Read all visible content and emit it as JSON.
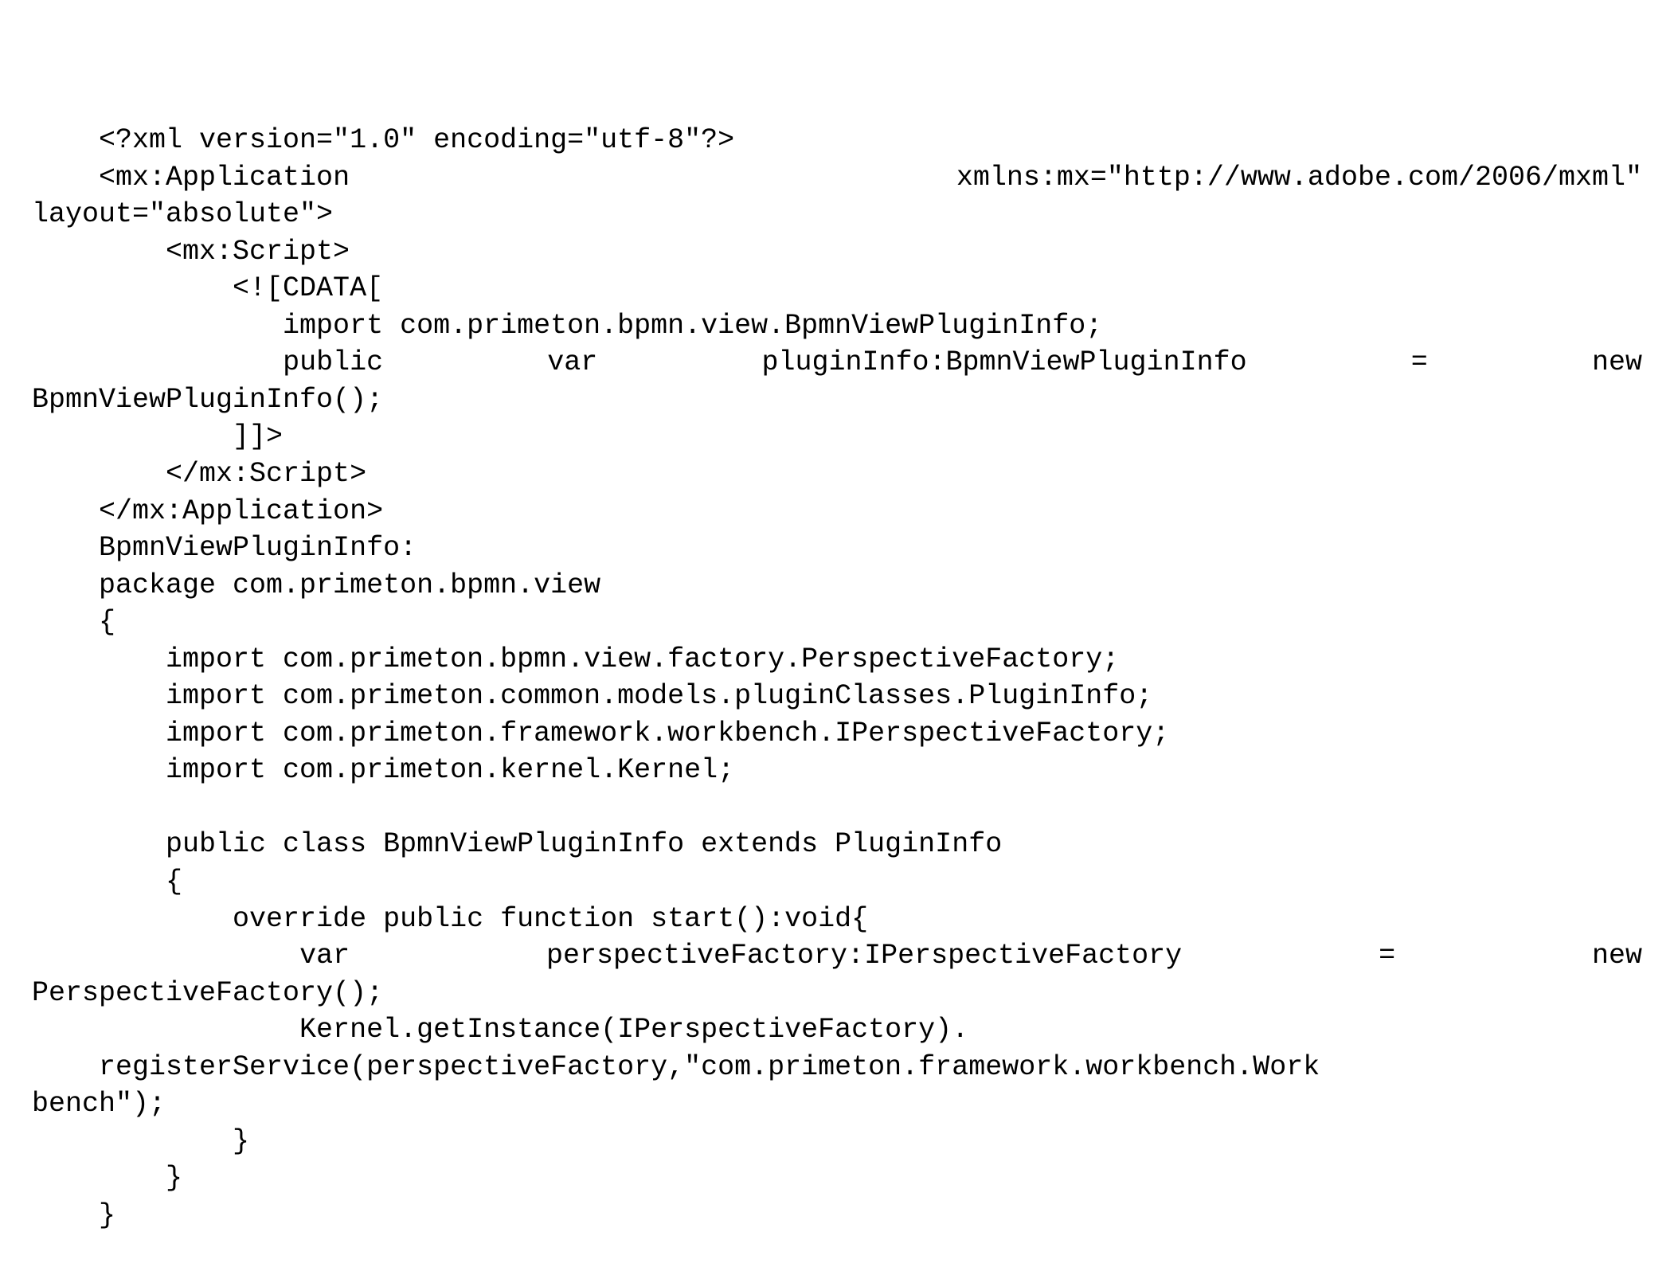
{
  "lines": [
    {
      "indent": "    ",
      "segs": [
        "<?xml version=\"1.0\" encoding=\"utf-8\"?>"
      ]
    },
    {
      "indent": "    ",
      "justify": true,
      "segs": [
        "<mx:Application",
        "xmlns:mx=\"http://www.adobe.com/2006/mxml\""
      ]
    },
    {
      "indent": "",
      "segs": [
        "layout=\"absolute\">"
      ]
    },
    {
      "indent": "        ",
      "segs": [
        "<mx:Script>"
      ]
    },
    {
      "indent": "            ",
      "segs": [
        "<![CDATA["
      ]
    },
    {
      "indent": "               ",
      "segs": [
        "import com.primeton.bpmn.view.BpmnViewPluginInfo;"
      ]
    },
    {
      "indent": "               ",
      "justify": true,
      "segs": [
        "public",
        "var",
        "pluginInfo:BpmnViewPluginInfo",
        "=",
        "new"
      ]
    },
    {
      "indent": "",
      "segs": [
        "BpmnViewPluginInfo();"
      ]
    },
    {
      "indent": "            ",
      "segs": [
        "]]>"
      ]
    },
    {
      "indent": "        ",
      "segs": [
        "</mx:Script>"
      ]
    },
    {
      "indent": "    ",
      "segs": [
        "</mx:Application>"
      ]
    },
    {
      "indent": "    ",
      "segs": [
        "BpmnViewPluginInfo:"
      ]
    },
    {
      "indent": "    ",
      "segs": [
        "package com.primeton.bpmn.view"
      ]
    },
    {
      "indent": "    ",
      "segs": [
        "{"
      ]
    },
    {
      "indent": "        ",
      "segs": [
        "import com.primeton.bpmn.view.factory.PerspectiveFactory;"
      ]
    },
    {
      "indent": "        ",
      "segs": [
        "import com.primeton.common.models.pluginClasses.PluginInfo;"
      ]
    },
    {
      "indent": "        ",
      "segs": [
        "import com.primeton.framework.workbench.IPerspectiveFactory;"
      ]
    },
    {
      "indent": "        ",
      "segs": [
        "import com.primeton.kernel.Kernel;"
      ]
    },
    {
      "indent": "",
      "segs": [
        ""
      ]
    },
    {
      "indent": "        ",
      "segs": [
        "public class BpmnViewPluginInfo extends PluginInfo"
      ]
    },
    {
      "indent": "        ",
      "segs": [
        "{"
      ]
    },
    {
      "indent": "            ",
      "segs": [
        "override public function start():void{"
      ]
    },
    {
      "indent": "                ",
      "justify": true,
      "segs": [
        "var",
        "perspectiveFactory:IPerspectiveFactory",
        "=",
        "new"
      ]
    },
    {
      "indent": "",
      "segs": [
        "PerspectiveFactory();"
      ]
    },
    {
      "indent": "                ",
      "segs": [
        "Kernel.getInstance(IPerspectiveFactory)."
      ]
    },
    {
      "indent": "    ",
      "segs": [
        "registerService(perspectiveFactory,\"com.primeton.framework.workbench.Work"
      ]
    },
    {
      "indent": "",
      "segs": [
        "bench\");"
      ]
    },
    {
      "indent": "            ",
      "segs": [
        "}"
      ]
    },
    {
      "indent": "        ",
      "segs": [
        "}"
      ]
    },
    {
      "indent": "    ",
      "segs": [
        "}"
      ]
    }
  ]
}
